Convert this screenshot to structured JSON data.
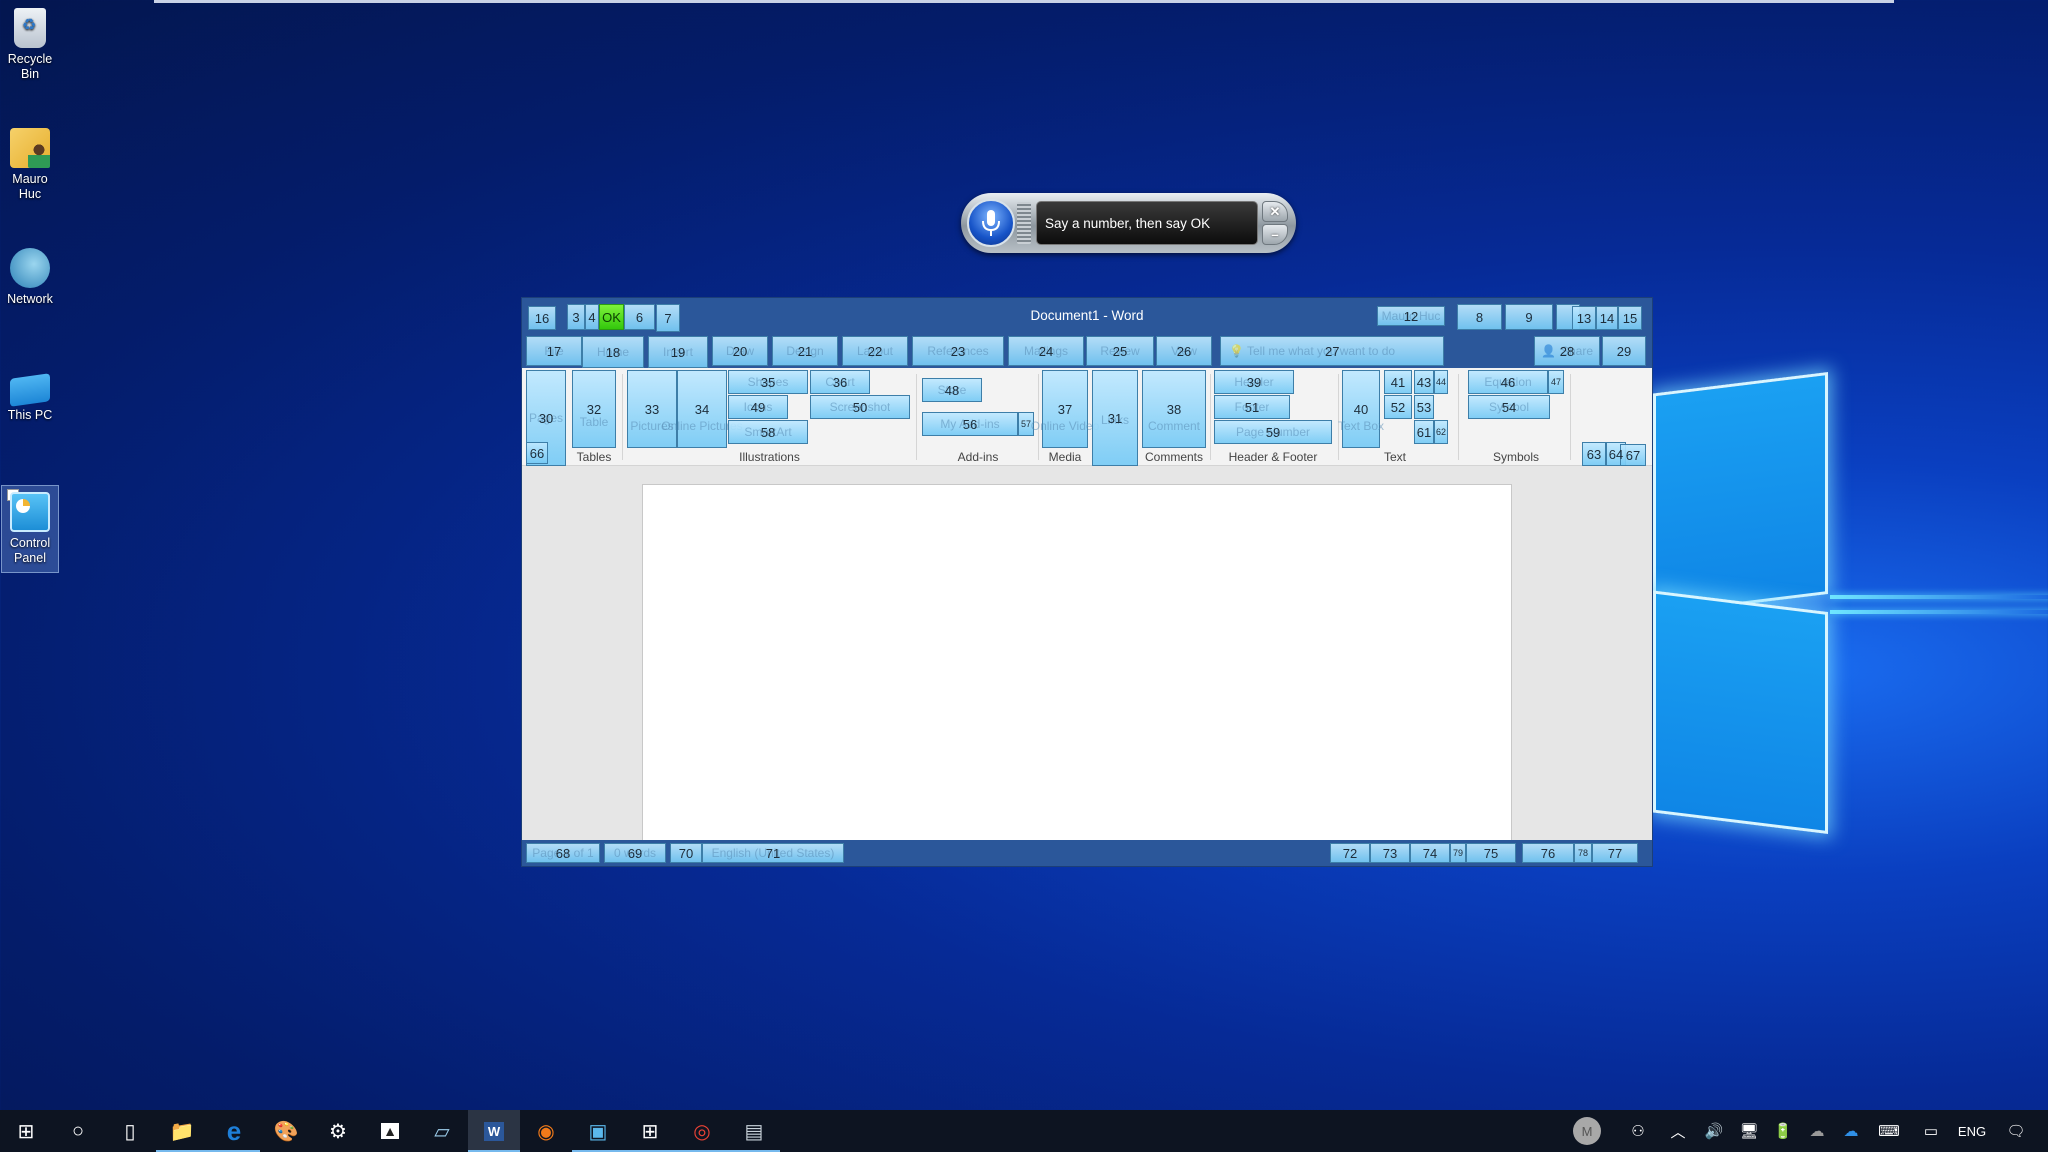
{
  "desktop": {
    "icons": [
      {
        "label": "Recycle Bin",
        "icon": "recycle-bin-icon"
      },
      {
        "label": "Mauro Huc",
        "icon": "user-folder-icon"
      },
      {
        "label": "Network",
        "icon": "network-icon"
      },
      {
        "label": "This PC",
        "icon": "this-pc-icon"
      },
      {
        "label": "Control Panel",
        "icon": "control-panel-icon",
        "selected": true
      }
    ]
  },
  "speech": {
    "prompt": "Say a number, then say OK",
    "close_glyph": "✕",
    "minimize_glyph": "–"
  },
  "word": {
    "title": "Document1  -  Word",
    "accent": "#2b579a",
    "overlay_color": "#8fd3f5",
    "ok_color": "#3ed614",
    "titlebar_tags": [
      {
        "num": "16",
        "ghost": ""
      },
      {
        "num": "3",
        "ghost": ""
      },
      {
        "num": "4",
        "ghost": ""
      },
      {
        "num": "OK",
        "ghost": ""
      },
      {
        "num": "6",
        "ghost": "▾"
      },
      {
        "num": "7",
        "ghost": ""
      },
      {
        "num": "12",
        "ghost": "Mauro Huc"
      },
      {
        "num": "8",
        "ghost": ""
      },
      {
        "num": "9",
        "ghost": ""
      },
      {
        "num": "13",
        "ghost": ""
      },
      {
        "num": "14",
        "ghost": ""
      },
      {
        "num": "15",
        "ghost": ""
      }
    ],
    "tabs": [
      {
        "num": "17",
        "label": "File"
      },
      {
        "num": "18",
        "label": "Home"
      },
      {
        "num": "19",
        "label": "Insert"
      },
      {
        "num": "20",
        "label": "Draw"
      },
      {
        "num": "21",
        "label": "Design"
      },
      {
        "num": "22",
        "label": "Layout"
      },
      {
        "num": "23",
        "label": "References"
      },
      {
        "num": "24",
        "label": "Mailings"
      },
      {
        "num": "25",
        "label": "Review"
      },
      {
        "num": "26",
        "label": "View"
      }
    ],
    "tell_me": {
      "num": "27",
      "placeholder": "Tell me what you want to do"
    },
    "share": {
      "num": "28",
      "label": "Share"
    },
    "comments_btn": {
      "num": "29"
    },
    "ribbon": {
      "groups": [
        "Tables",
        "Illustrations",
        "Add-ins",
        "Media",
        "Comments",
        "Header & Footer",
        "Text",
        "Symbols"
      ],
      "items": [
        {
          "num": "30",
          "label": "Pages"
        },
        {
          "num": "66",
          "label": ""
        },
        {
          "num": "32",
          "label": "Table"
        },
        {
          "num": "33",
          "label": "Pictures"
        },
        {
          "num": "34",
          "label": "Online Pictures"
        },
        {
          "num": "35",
          "label": "Shapes"
        },
        {
          "num": "36",
          "label": "Chart"
        },
        {
          "num": "49",
          "label": "Icons"
        },
        {
          "num": "50",
          "label": "Screenshot"
        },
        {
          "num": "58",
          "label": "SmartArt"
        },
        {
          "num": "48",
          "label": "Store"
        },
        {
          "num": "56",
          "label": "My Add-ins"
        },
        {
          "num": "57",
          "label": ""
        },
        {
          "num": "37",
          "label": "Online Video"
        },
        {
          "num": "31",
          "label": "Links"
        },
        {
          "num": "38",
          "label": "Comment"
        },
        {
          "num": "39",
          "label": "Header"
        },
        {
          "num": "51",
          "label": "Footer"
        },
        {
          "num": "59",
          "label": "Page Number"
        },
        {
          "num": "40",
          "label": "Text Box"
        },
        {
          "num": "41",
          "label": ""
        },
        {
          "num": "43",
          "label": ""
        },
        {
          "num": "44",
          "label": ""
        },
        {
          "num": "52",
          "label": ""
        },
        {
          "num": "53",
          "label": ""
        },
        {
          "num": "61",
          "label": ""
        },
        {
          "num": "62",
          "label": ""
        },
        {
          "num": "46",
          "label": "Equation"
        },
        {
          "num": "47",
          "label": ""
        },
        {
          "num": "54",
          "label": "Symbol"
        },
        {
          "num": "63",
          "label": ""
        },
        {
          "num": "64",
          "label": ""
        },
        {
          "num": "67",
          "label": ""
        }
      ]
    },
    "status": {
      "left": [
        {
          "num": "68",
          "label": "Page 1 of 1"
        },
        {
          "num": "69",
          "label": "0 words"
        },
        {
          "num": "70",
          "label": ""
        },
        {
          "num": "71",
          "label": "English (United States)"
        }
      ],
      "right": [
        {
          "num": "72"
        },
        {
          "num": "73"
        },
        {
          "num": "74"
        },
        {
          "num": "79"
        },
        {
          "num": "75"
        },
        {
          "num": "76"
        },
        {
          "num": "78"
        },
        {
          "num": "77"
        }
      ]
    }
  },
  "taskbar": {
    "apps": [
      {
        "name": "start",
        "glyph": "⊞"
      },
      {
        "name": "search",
        "glyph": "○"
      },
      {
        "name": "task-view",
        "glyph": "▯"
      },
      {
        "name": "file-explorer",
        "glyph": "📁"
      },
      {
        "name": "edge",
        "glyph": "e"
      },
      {
        "name": "paint",
        "glyph": "🎨"
      },
      {
        "name": "settings",
        "glyph": "⚙"
      },
      {
        "name": "photos",
        "glyph": "▲"
      },
      {
        "name": "notepad",
        "glyph": "▱"
      },
      {
        "name": "word",
        "glyph": "W"
      },
      {
        "name": "firefox",
        "glyph": "◉"
      },
      {
        "name": "control-panel",
        "glyph": "▣"
      },
      {
        "name": "store",
        "glyph": "⊞"
      },
      {
        "name": "chrome",
        "glyph": "◎"
      },
      {
        "name": "task-manager",
        "glyph": "▤"
      }
    ],
    "tray": {
      "avatar_letter": "M",
      "language": "ENG"
    }
  }
}
